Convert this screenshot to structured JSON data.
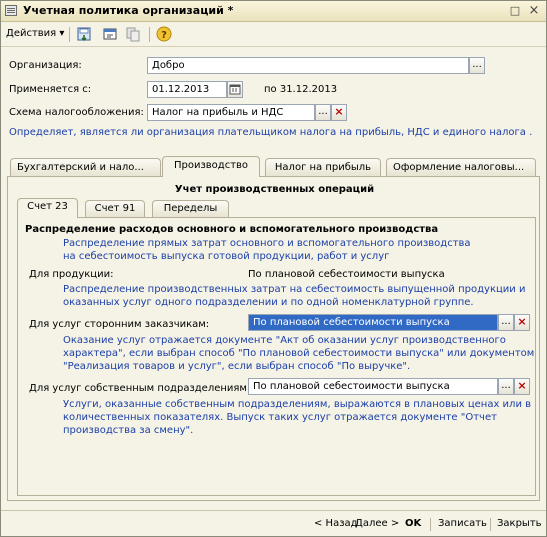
{
  "window": {
    "title": "Учетная политика организаций *",
    "max_glyph": "□",
    "close_glyph": "×"
  },
  "toolbar": {
    "actions_label": "Действия",
    "dropdown_glyph": "▾",
    "help_glyph": "?"
  },
  "form": {
    "org_label": "Организация:",
    "org_value": "Добро",
    "applies_label": "Применяется с:",
    "date_from": "01.12.2013",
    "date_to_text": "по 31.12.2013",
    "tax_scheme_label": "Схема налогообложения:",
    "tax_scheme_value": "Налог на прибыль и НДС",
    "hint": "Определяет, является ли организация плательщиком налога на прибыль, НДС и единого налога ."
  },
  "tabs": [
    "Бухгалтерский и нало...",
    "Производство",
    "Налог на прибыль",
    "Оформление налоговы..."
  ],
  "section_title": "Учет производственных операций",
  "inner_tabs": [
    "Счет 23",
    "Счет 91",
    "Переделы"
  ],
  "content": {
    "heading": "Распределение расходов основного и вспомогательного производства",
    "heading_hint_1": "Распределение прямых затрат основного и вспомогательного производства",
    "heading_hint_2": "на себестоимость выпуска готовой продукции, работ и услуг",
    "products_label": "Для продукции:",
    "products_value": "По плановой себестоимости выпуска",
    "products_hint_1": "Распределение производственных затрат на себестоимость выпущенной продукции и",
    "products_hint_2": "оказанных услуг одного подразделении и по одной номенклатурной группе.",
    "external_label": "Для услуг сторонним заказчикам:",
    "external_value": "По плановой себестоимости выпуска",
    "external_hint_1": "Оказание услуг отражается документе \"Акт об оказании услуг производственного",
    "external_hint_2": "характера\", если выбран способ \"По плановой себестоимости выпуска\" или документом",
    "external_hint_3": "\"Реализация товаров и услуг\", если выбран способ \"По выручке\".",
    "own_label": "Для услуг собственным подразделениям:",
    "own_value": "По плановой себестоимости выпуска",
    "own_hint_1": "Услуги, оказанные собственным подразделениям, выражаются в плановых ценах или в",
    "own_hint_2": "количественных показателях. Выпуск таких услуг отражается документе \"Отчет",
    "own_hint_3": "производства за смену\"."
  },
  "picker": {
    "ellipsis": "...",
    "clear": "×"
  },
  "footer": {
    "back": "< Назад",
    "next": "Далее >",
    "ok": "OK",
    "save": "Записать",
    "close": "Закрыть"
  },
  "colors": {
    "hint_text": "#1a3fa8",
    "selection": "#316ac5",
    "window_bg": "#f5f2e6"
  }
}
